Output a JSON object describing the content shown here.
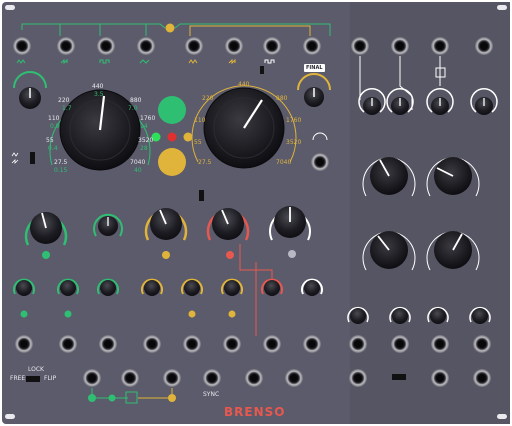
{
  "module": {
    "brand": "BRENSO",
    "final_label": "FINAL",
    "free_label": "FREE",
    "flip_label": "FLIP",
    "lock_label": "LOCK",
    "sync_label": "SYNC"
  },
  "colors": {
    "panel": "#5b5b6b",
    "green": "#2fbf72",
    "yellow": "#e0b43a",
    "red": "#e8584e",
    "white": "#ffffff",
    "brand": "#e8584e"
  },
  "dial_left": {
    "scale": [
      "440",
      "220",
      "880",
      "110",
      "1760",
      "55",
      "3520",
      "27.5",
      "7040"
    ],
    "sub": [
      "3.5",
      "1.7",
      "7.0",
      "0.9",
      "14",
      "0.4",
      "28",
      "0.15",
      "40"
    ]
  },
  "dial_right": {
    "scale": [
      "440",
      "220",
      "880",
      "110",
      "1760",
      "55",
      "3520",
      "27.5",
      "7040"
    ]
  },
  "buttons": [
    "green-pad",
    "yellow-pad"
  ],
  "leds": [
    "green",
    "red",
    "yellow"
  ]
}
